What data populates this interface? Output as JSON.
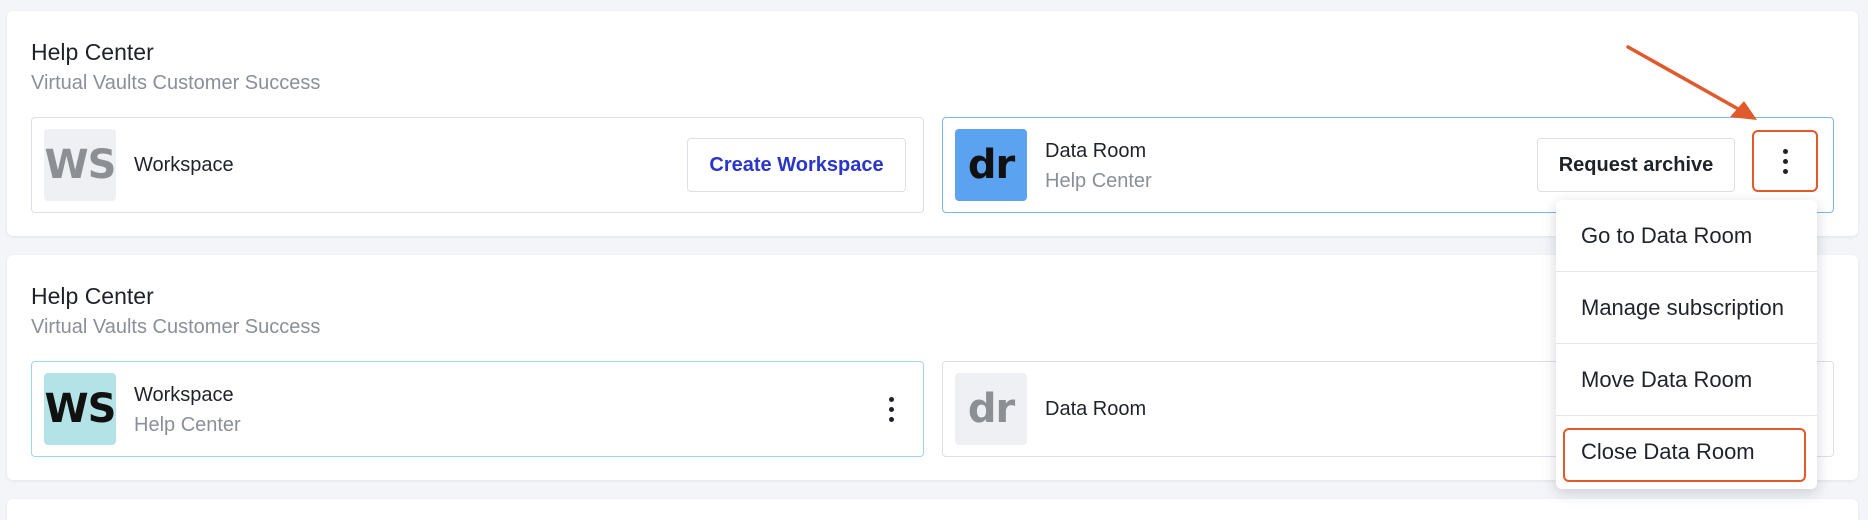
{
  "colors": {
    "accent_orange": "#e05a2b",
    "link_blue": "#2a35c9",
    "dataroom_blue": "#5ba3f0",
    "workspace_teal": "#b3e3e6"
  },
  "groups": [
    {
      "title": "Help Center",
      "subtitle": "Virtual Vaults Customer Success",
      "workspace": {
        "logo": "WS",
        "name": "Workspace",
        "button": "Create Workspace"
      },
      "dataroom": {
        "logo": "dr",
        "name": "Data Room",
        "subtitle": "Help Center",
        "button": "Request archive",
        "more_icon": "kebab-vertical-icon"
      }
    },
    {
      "title": "Help Center",
      "subtitle": "Virtual Vaults Customer Success",
      "workspace": {
        "logo": "WS",
        "name": "Workspace",
        "subtitle": "Help Center",
        "more_icon": "kebab-vertical-icon"
      },
      "dataroom": {
        "logo": "dr",
        "name": "Data Room"
      }
    }
  ],
  "menu": {
    "items": [
      "Go to Data Room",
      "Manage subscription",
      "Move Data Room",
      "Close Data Room"
    ]
  }
}
